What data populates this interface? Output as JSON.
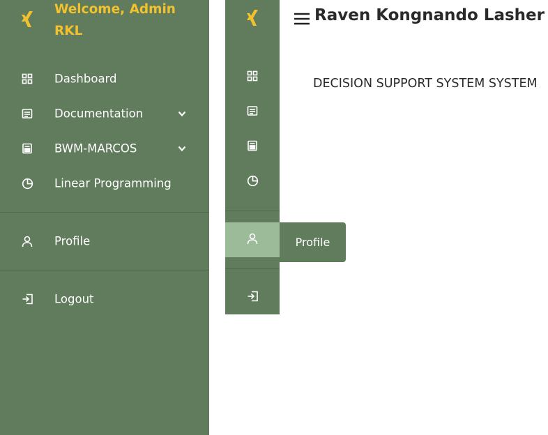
{
  "sidebar": {
    "welcome": "Welcome, Admin RKL",
    "menu": [
      {
        "label": "Dashboard",
        "icon": "dashboard-icon"
      },
      {
        "label": "Documentation",
        "icon": "document-icon",
        "has_submenu": true
      },
      {
        "label": "BWM-MARCOS",
        "icon": "calculator-icon",
        "has_submenu": true
      },
      {
        "label": "Linear Programming",
        "icon": "pie-chart-icon"
      },
      {
        "label": "Profile",
        "icon": "user-icon"
      },
      {
        "label": "Logout",
        "icon": "logout-icon"
      }
    ]
  },
  "mini_sidebar": {
    "tooltip": "Profile"
  },
  "header": {
    "title": "Raven Kongnando Lasher"
  },
  "main": {
    "text": "DECISION SUPPORT SYSTEM SYSTEM"
  },
  "colors": {
    "sidebar_bg": "#607c5c",
    "accent": "#f2c12e",
    "active_bg": "#9bbb99"
  }
}
